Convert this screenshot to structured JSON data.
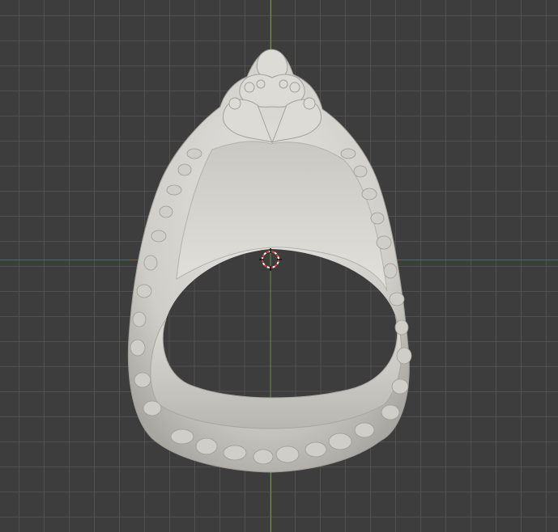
{
  "viewport": {
    "background_color": "#3d3d3d",
    "grid_color": "#525252",
    "x_axis_color": "#c0333f",
    "y_axis_color": "#6b9a2f"
  },
  "model": {
    "object": "ring",
    "surface_color": "#d6d5d0"
  },
  "cursor": {
    "icon": "3d-cursor-icon",
    "ring_colors": [
      "#ff3b3b",
      "#ffffff"
    ]
  }
}
